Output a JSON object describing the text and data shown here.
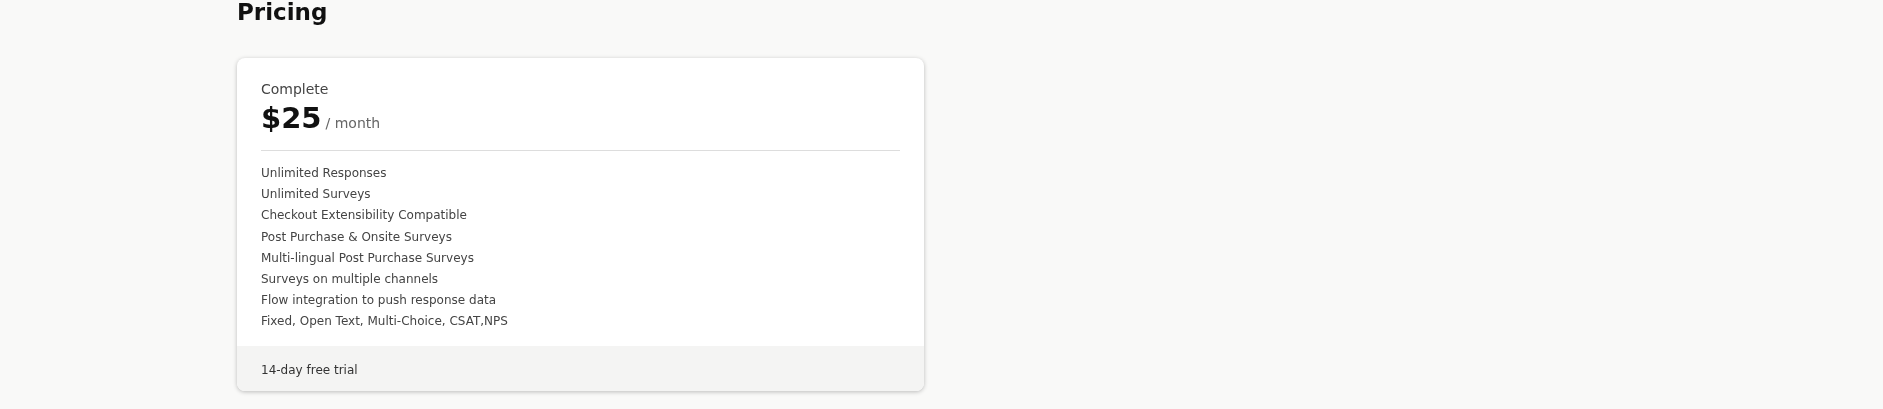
{
  "heading": "Pricing",
  "plan": {
    "name": "Complete",
    "price": "$25",
    "period": "/ month",
    "features": [
      "Unlimited Responses",
      "Unlimited Surveys",
      "Checkout Extensibility Compatible",
      "Post Purchase & Onsite Surveys",
      "Multi-lingual Post Purchase Surveys",
      "Surveys on multiple channels",
      "Flow integration to push response data",
      "Fixed, Open Text, Multi-Choice, CSAT,NPS"
    ],
    "footer": "14-day free trial"
  }
}
